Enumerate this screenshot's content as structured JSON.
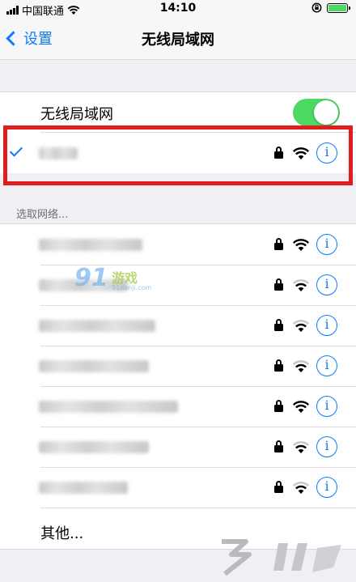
{
  "status_bar": {
    "carrier": "中国联通",
    "time": "14:10",
    "battery_color": "#4cd964"
  },
  "nav": {
    "back_label": "设置",
    "title": "无线局域网"
  },
  "wifi_section": {
    "toggle_label": "无线局域网",
    "toggle_on": true,
    "connected_network": {
      "name_blurred": true,
      "secured": true,
      "signal": "full"
    }
  },
  "networks_header": "选取网络...",
  "networks": [
    {
      "name_blurred": true,
      "secured": true,
      "signal": "full"
    },
    {
      "name_blurred": true,
      "secured": true,
      "signal": "medium"
    },
    {
      "name_blurred": true,
      "secured": true,
      "signal": "medium"
    },
    {
      "name_blurred": true,
      "secured": true,
      "signal": "medium"
    },
    {
      "name_blurred": true,
      "secured": true,
      "signal": "full"
    },
    {
      "name_blurred": true,
      "secured": true,
      "signal": "medium"
    },
    {
      "name_blurred": true,
      "secured": true,
      "signal": "medium"
    }
  ],
  "other_label": "其他...",
  "watermark": {
    "logo": "91",
    "text": "游戏",
    "url": "91danji.com"
  },
  "colors": {
    "accent": "#0a7cff",
    "highlight": "#e11d1d",
    "toggle_on": "#4cd964"
  }
}
